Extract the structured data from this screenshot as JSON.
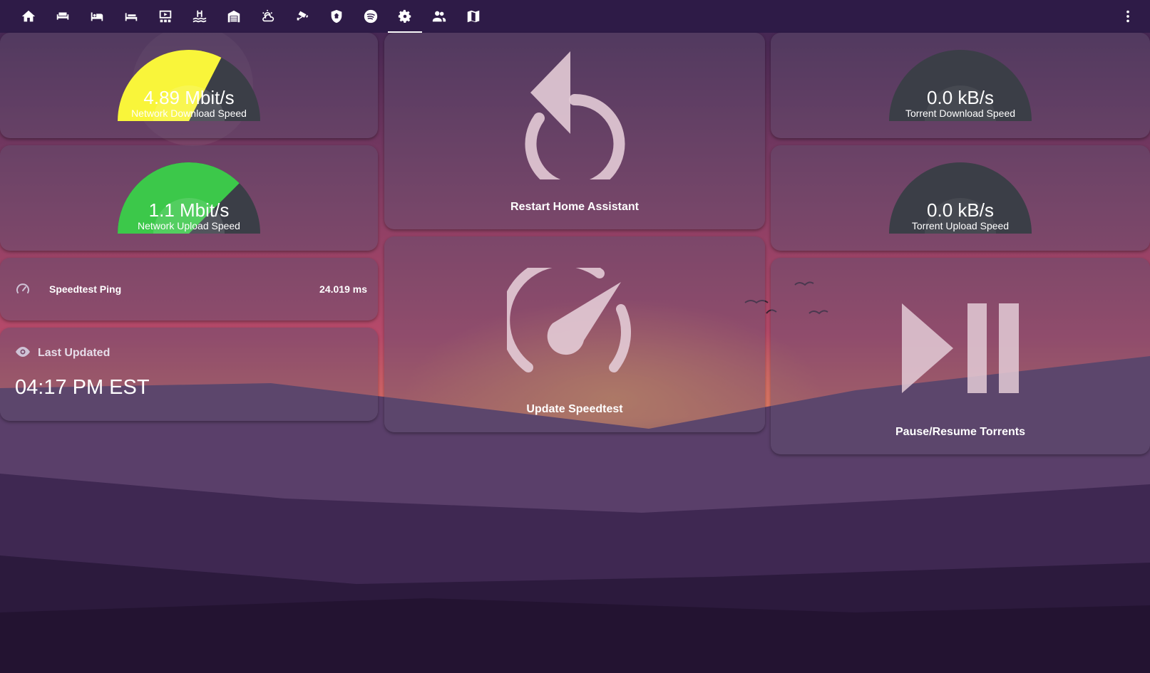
{
  "nav": {
    "tabs": [
      {
        "icon": "home-icon"
      },
      {
        "icon": "sofa-icon"
      },
      {
        "icon": "bed-icon"
      },
      {
        "icon": "bed-single-icon"
      },
      {
        "icon": "theater-icon"
      },
      {
        "icon": "pool-icon"
      },
      {
        "icon": "garage-icon"
      },
      {
        "icon": "weather-partly-cloudy-icon"
      },
      {
        "icon": "cctv-icon"
      },
      {
        "icon": "shield-home-icon"
      },
      {
        "icon": "spotify-icon"
      },
      {
        "icon": "settings-icon",
        "active": true
      },
      {
        "icon": "account-group-icon"
      },
      {
        "icon": "map-icon"
      }
    ],
    "menu_icon": "dots-vertical-icon"
  },
  "cards": {
    "network_download": {
      "value": "4.89 Mbit/s",
      "name": "Network Download Speed",
      "level": 0.65,
      "color": "#f9f53a"
    },
    "network_upload": {
      "value": "1.1 Mbit/s",
      "name": "Network Upload Speed",
      "level": 0.75,
      "color": "#3cc84a"
    },
    "speedtest_ping": {
      "name": "Speedtest Ping",
      "state": "24.019 ms",
      "icon": "speedometer-icon"
    },
    "last_updated": {
      "title": "Last Updated",
      "value": "04:17 PM EST",
      "icon": "eye-icon"
    },
    "restart": {
      "label": "Restart Home Assistant",
      "icon": "restart-icon"
    },
    "update_speedtest": {
      "label": "Update Speedtest",
      "icon": "speedometer-large-icon"
    },
    "torrent_download": {
      "value": "0.0 kB/s",
      "name": "Torrent Download Speed",
      "level": 0
    },
    "torrent_upload": {
      "value": "0.0 kB/s",
      "name": "Torrent Upload Speed",
      "level": 0
    },
    "pause_resume": {
      "label": "Pause/Resume Torrents",
      "icon": "play-pause-icon"
    }
  },
  "colors": {
    "gauge_track": "#3b3e47",
    "topbar": "#2e1b47"
  }
}
